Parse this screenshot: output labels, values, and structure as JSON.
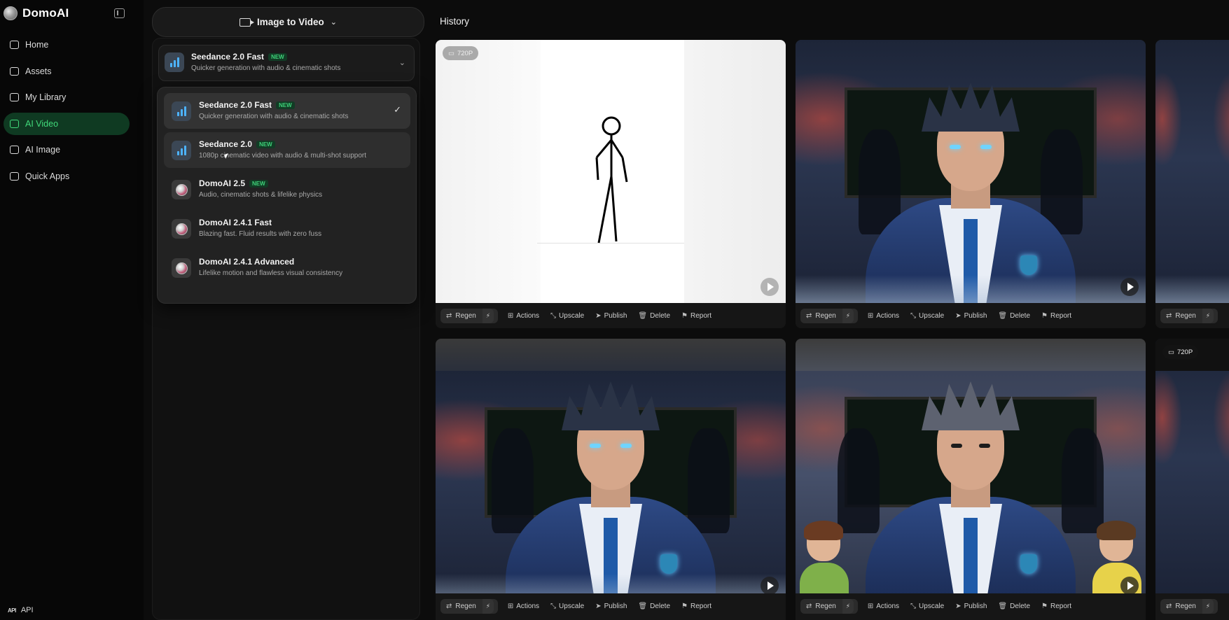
{
  "app": {
    "name": "DomoAI"
  },
  "sidebar": {
    "items": [
      {
        "label": "Home",
        "icon": "home-icon"
      },
      {
        "label": "Assets",
        "icon": "assets-icon"
      },
      {
        "label": "My Library",
        "icon": "library-icon"
      },
      {
        "label": "AI Video",
        "icon": "video-icon",
        "active": true
      },
      {
        "label": "AI Image",
        "icon": "image-icon"
      },
      {
        "label": "Quick Apps",
        "icon": "apps-icon"
      }
    ],
    "api_label": "API",
    "api_icon_text": "API"
  },
  "mode_selector": {
    "label": "Image to Video"
  },
  "selected_model": {
    "name": "Seedance 2.0 Fast",
    "badge": "NEW",
    "desc": "Quicker generation with audio & cinematic shots"
  },
  "models": [
    {
      "name": "Seedance 2.0 Fast",
      "badge": "NEW",
      "desc": "Quicker generation with audio & cinematic shots",
      "selected": true
    },
    {
      "name": "Seedance 2.0",
      "badge": "NEW",
      "desc": "1080p cinematic video with audio & multi-shot support"
    },
    {
      "name": "DomoAI 2.5",
      "badge": "NEW",
      "desc": "Audio, cinematic shots & lifelike physics"
    },
    {
      "name": "DomoAI 2.4.1 Fast",
      "badge": "",
      "desc": "Blazing fast. Fluid results with zero fuss"
    },
    {
      "name": "DomoAI 2.4.1 Advanced",
      "badge": "",
      "desc": "Lifelike motion and flawless visual consistency"
    }
  ],
  "history": {
    "title": "History",
    "resolution_badge": "720P",
    "actions": {
      "regen": "Regen",
      "actions": "Actions",
      "upscale": "Upscale",
      "publish": "Publish",
      "delete": "Delete",
      "report": "Report"
    }
  },
  "colors": {
    "accent_green": "#41d97a",
    "active_bg": "#0f3a22",
    "badge_green": "#3ed078"
  }
}
